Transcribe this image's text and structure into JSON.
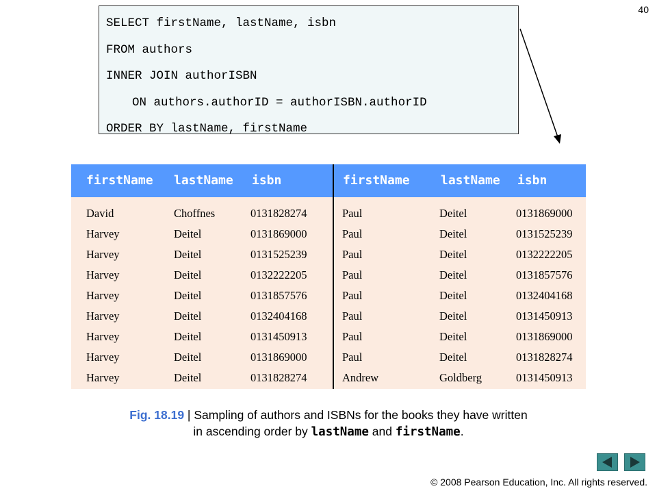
{
  "page_number": "40",
  "sql": {
    "lines": [
      "SELECT firstName, lastName, isbn",
      "FROM authors",
      "INNER JOIN authorISBN",
      "ON authors.authorID = authorISBN.authorID",
      "ORDER BY lastName, firstName"
    ]
  },
  "table": {
    "headers": [
      "firstName",
      "lastName",
      "isbn",
      "firstName",
      "lastName",
      "isbn"
    ],
    "left_rows": [
      [
        "David",
        "Choffnes",
        "0131828274"
      ],
      [
        "Harvey",
        "Deitel",
        "0131869000"
      ],
      [
        "Harvey",
        "Deitel",
        "0131525239"
      ],
      [
        "Harvey",
        "Deitel",
        "0132222205"
      ],
      [
        "Harvey",
        "Deitel",
        "0131857576"
      ],
      [
        "Harvey",
        "Deitel",
        "0132404168"
      ],
      [
        "Harvey",
        "Deitel",
        "0131450913"
      ],
      [
        "Harvey",
        "Deitel",
        "0131869000"
      ],
      [
        "Harvey",
        "Deitel",
        "0131828274"
      ]
    ],
    "right_rows": [
      [
        "Paul",
        "Deitel",
        "0131869000"
      ],
      [
        "Paul",
        "Deitel",
        "0131525239"
      ],
      [
        "Paul",
        "Deitel",
        "0132222205"
      ],
      [
        "Paul",
        "Deitel",
        "0131857576"
      ],
      [
        "Paul",
        "Deitel",
        "0132404168"
      ],
      [
        "Paul",
        "Deitel",
        "0131450913"
      ],
      [
        "Paul",
        "Deitel",
        "0131869000"
      ],
      [
        "Paul",
        "Deitel",
        "0131828274"
      ],
      [
        "Andrew",
        "Goldberg",
        "0131450913"
      ]
    ]
  },
  "caption": {
    "fig_num": "Fig. 18.19",
    "separator": " | ",
    "line1": "Sampling of authors and ISBNs for the books they have written",
    "line2_prefix": "in ascending order by ",
    "code1": "lastName",
    "and_text": " and ",
    "code2": "firstName",
    "period": "."
  },
  "navigation": {
    "prev_icon": "left-triangle-icon",
    "next_icon": "right-triangle-icon"
  },
  "copyright": "© 2008 Pearson Education, Inc.  All rights reserved.",
  "colors": {
    "header_blue": "#5599ff",
    "body_peach": "#fcebe0",
    "sql_bg": "#f0f7f8",
    "caption_blue": "#3d6fd0",
    "nav_teal": "#3b8f8f"
  }
}
